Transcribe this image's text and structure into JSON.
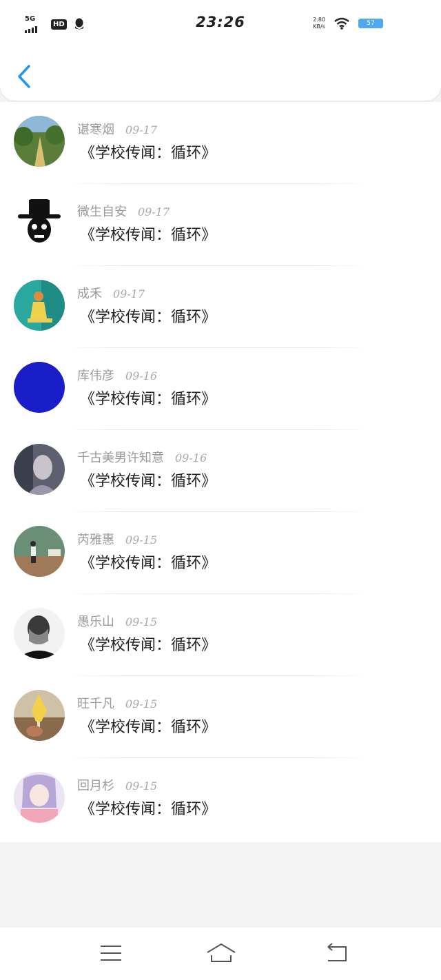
{
  "status_bar": {
    "network": "5G",
    "hd_badge": "HD",
    "time": "23:26",
    "speed_value": "2.80",
    "speed_unit": "KB/s",
    "battery_text": "57"
  },
  "header": {
    "back_icon": "chevron-left-icon"
  },
  "items": [
    {
      "name": "谌寒烟",
      "date": "09-17",
      "title": "《学校传闻：循环》"
    },
    {
      "name": "微生自安",
      "date": "09-17",
      "title": "《学校传闻：循环》"
    },
    {
      "name": "成禾",
      "date": "09-17",
      "title": "《学校传闻：循环》"
    },
    {
      "name": "库伟彦",
      "date": "09-16",
      "title": "《学校传闻：循环》"
    },
    {
      "name": "千古美男许知意",
      "date": "09-16",
      "title": "《学校传闻：循环》"
    },
    {
      "name": "芮雅惠",
      "date": "09-15",
      "title": "《学校传闻：循环》"
    },
    {
      "name": "愚乐山",
      "date": "09-15",
      "title": "《学校传闻：循环》"
    },
    {
      "name": "旺千凡",
      "date": "09-15",
      "title": "《学校传闻：循环》"
    },
    {
      "name": "回月杉",
      "date": "09-15",
      "title": "《学校传闻：循环》"
    }
  ],
  "nav": {
    "menu_icon": "menu-icon",
    "home_icon": "home-icon",
    "back_icon": "back-icon"
  },
  "colors": {
    "accent": "#2196f3",
    "name_gray": "#9a9a9a",
    "title_black": "#222222"
  }
}
